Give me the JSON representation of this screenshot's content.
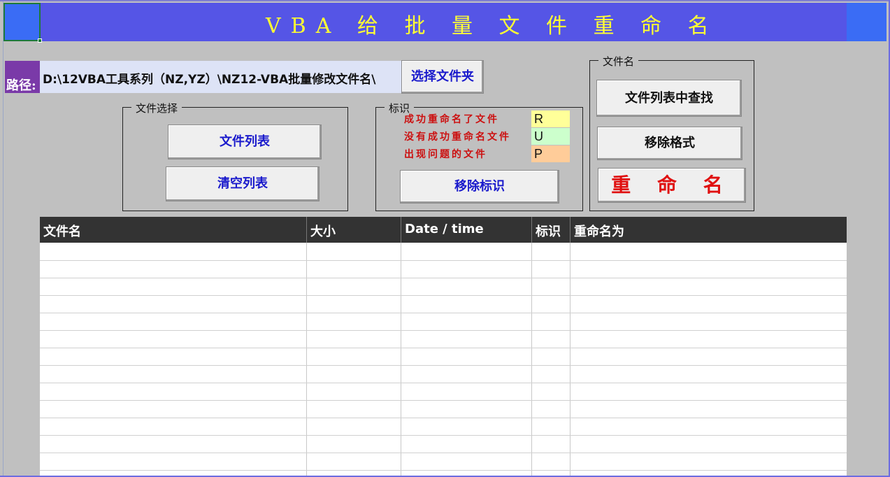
{
  "title": "VBA 给 批 量 文 件 重 命 名",
  "path": {
    "label": "路径:",
    "value": "D:\\12VBA工具系列（NZ,YZ）\\NZ12-VBA批量修改文件名\\",
    "select_folder_button": "选择文件夹"
  },
  "file_select_group": {
    "label": "文件选择",
    "file_list_button": "文件列表",
    "clear_list_button": "清空列表"
  },
  "marker_group": {
    "label": "标识",
    "legend": [
      {
        "text": "成功重命名了文件",
        "code": "R",
        "color": "#ffff99"
      },
      {
        "text": "没有成功重命名文件",
        "code": "U",
        "color": "#ccffcc"
      },
      {
        "text": "出现问题的文件",
        "code": "P",
        "color": "#ffcc99"
      }
    ],
    "remove_markers_button": "移除标识"
  },
  "filename_group": {
    "label": "文件名",
    "find_in_list_button": "文件列表中查找",
    "remove_format_button": "移除格式",
    "rename_button": "重 命 名"
  },
  "table": {
    "columns": [
      "文件名",
      "大小",
      "Date / time",
      "标识",
      "重命名为"
    ],
    "rows": []
  },
  "colors": {
    "title_bg": "#5555e6",
    "title_text": "#ffff33",
    "header_bg": "#333333",
    "rename_text": "#e01010"
  }
}
